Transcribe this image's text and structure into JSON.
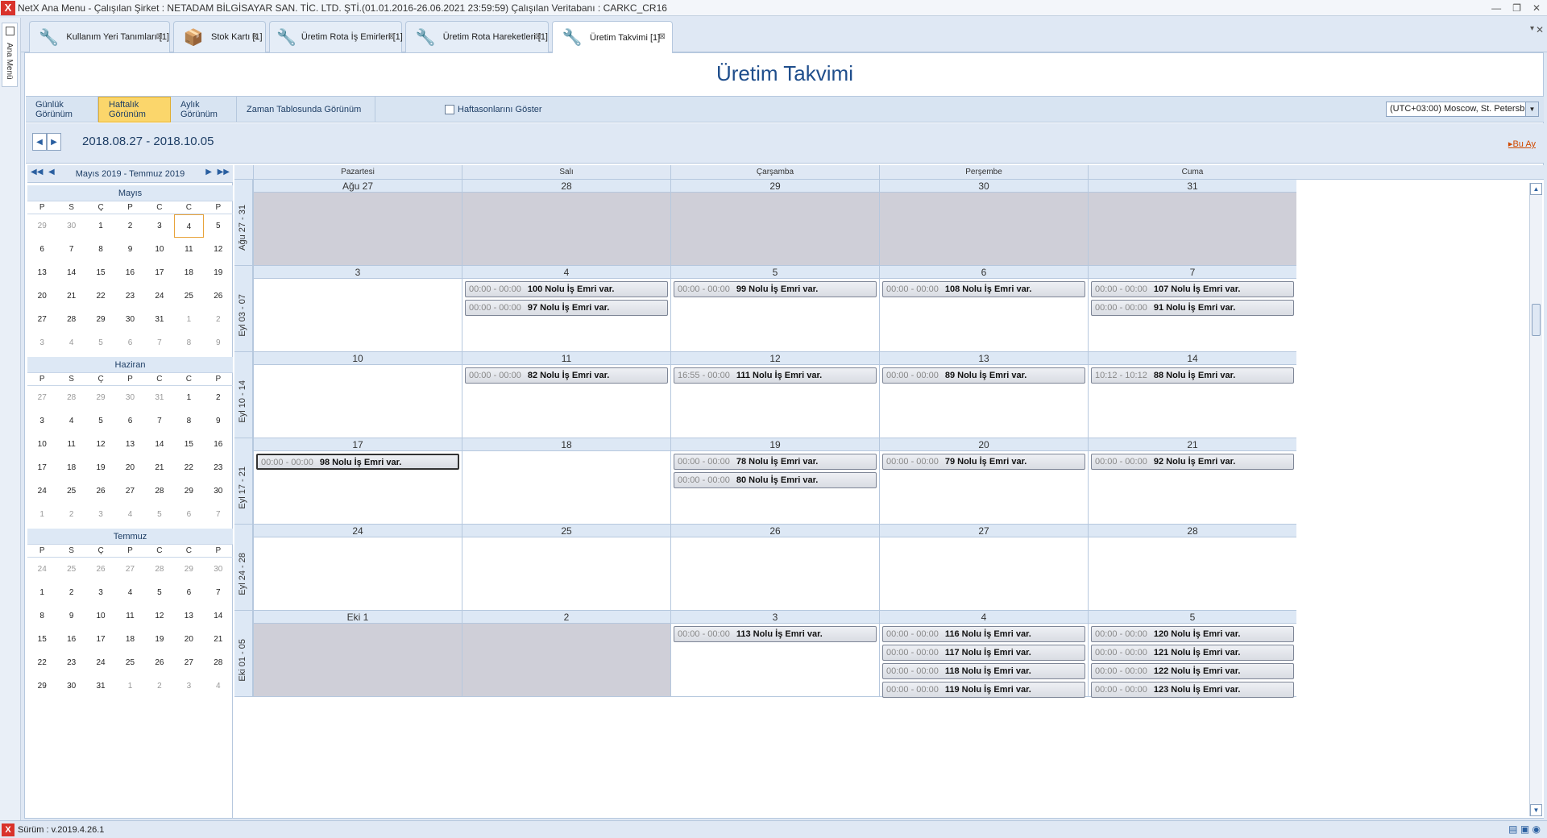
{
  "window": {
    "title": "NetX Ana Menu - Çalışılan Şirket : NETADAM BİLGİSAYAR SAN. TİC. LTD. ŞTİ.(01.01.2016-26.06.2021 23:59:59) Çalışılan Veritabanı : CARKC_CR16",
    "app_icon": "X",
    "min": "—",
    "restore": "❐",
    "close": "✕"
  },
  "left_strip": {
    "label": "Ana Menü"
  },
  "tabs": [
    {
      "label": "Kullanım Yeri Tanımları [1]",
      "icon": "tools-icon",
      "glyph": "🔧",
      "active": false
    },
    {
      "label": "Stok Kartı [1]",
      "icon": "boxes-icon",
      "glyph": "📦",
      "active": false
    },
    {
      "label": "Üretim Rota İş Emirleri [1]",
      "icon": "tools-icon",
      "glyph": "🔧",
      "active": false
    },
    {
      "label": "Üretim Rota Hareketleri [1]",
      "icon": "tools-icon",
      "glyph": "🔧",
      "active": false
    },
    {
      "label": "Üretim Takvimi [1]",
      "icon": "tools-icon",
      "glyph": "🔧",
      "active": true
    }
  ],
  "tab_close": "⊠",
  "page_title": "Üretim Takvimi",
  "toolbar": {
    "views": [
      "Günlük Görünüm",
      "Haftalık Görünüm",
      "Aylık Görünüm",
      "Zaman Tablosunda Görünüm"
    ],
    "active_view": "Haftalık Görünüm",
    "weekend_checkbox": "Haftasonlarını Göster",
    "timezone": "(UTC+03:00) Moscow, St. Petersbu"
  },
  "nav": {
    "date_range": "2018.08.27 - 2018.10.05",
    "bu_ay": "Bu Ay"
  },
  "minical": {
    "header": "Mayıs 2019 - Temmuz 2019",
    "weekdays": [
      "P",
      "S",
      "Ç",
      "P",
      "C",
      "C",
      "P"
    ],
    "months": [
      {
        "name": "Mayıs",
        "days": [
          "29",
          "30",
          "1",
          "2",
          "3",
          "4",
          "5",
          "6",
          "7",
          "8",
          "9",
          "10",
          "11",
          "12",
          "13",
          "14",
          "15",
          "16",
          "17",
          "18",
          "19",
          "20",
          "21",
          "22",
          "23",
          "24",
          "25",
          "26",
          "27",
          "28",
          "29",
          "30",
          "31",
          "1",
          "2",
          "3",
          "4",
          "5",
          "6",
          "7",
          "8",
          "9"
        ],
        "first_in": 2,
        "last_in": 32,
        "today": 5
      },
      {
        "name": "Haziran",
        "days": [
          "27",
          "28",
          "29",
          "30",
          "31",
          "1",
          "2",
          "3",
          "4",
          "5",
          "6",
          "7",
          "8",
          "9",
          "10",
          "11",
          "12",
          "13",
          "14",
          "15",
          "16",
          "17",
          "18",
          "19",
          "20",
          "21",
          "22",
          "23",
          "24",
          "25",
          "26",
          "27",
          "28",
          "29",
          "30",
          "1",
          "2",
          "3",
          "4",
          "5",
          "6",
          "7"
        ],
        "first_in": 5,
        "last_in": 34,
        "today": -1
      },
      {
        "name": "Temmuz",
        "days": [
          "24",
          "25",
          "26",
          "27",
          "28",
          "29",
          "30",
          "1",
          "2",
          "3",
          "4",
          "5",
          "6",
          "7",
          "8",
          "9",
          "10",
          "11",
          "12",
          "13",
          "14",
          "15",
          "16",
          "17",
          "18",
          "19",
          "20",
          "21",
          "22",
          "23",
          "24",
          "25",
          "26",
          "27",
          "28",
          "29",
          "30",
          "31",
          "1",
          "2",
          "3",
          "4"
        ],
        "first_in": 7,
        "last_in": 37,
        "today": -1
      }
    ]
  },
  "calendar": {
    "day_headers": [
      "Pazartesi",
      "Salı",
      "Çarşamba",
      "Perşembe",
      "Cuma"
    ],
    "weeks": [
      {
        "label": "Ağu 27 - 31",
        "grey": true,
        "days": [
          {
            "d": "Ağu 27",
            "e": []
          },
          {
            "d": "28",
            "e": []
          },
          {
            "d": "29",
            "e": []
          },
          {
            "d": "30",
            "e": []
          },
          {
            "d": "31",
            "e": []
          }
        ]
      },
      {
        "label": "Eyl 03 - 07",
        "grey": false,
        "days": [
          {
            "d": "3",
            "e": []
          },
          {
            "d": "4",
            "e": [
              {
                "t": "00:00 - 00:00",
                "x": "100 Nolu İş Emri var."
              },
              {
                "t": "00:00 - 00:00",
                "x": "97 Nolu İş Emri var."
              }
            ]
          },
          {
            "d": "5",
            "e": [
              {
                "t": "00:00 - 00:00",
                "x": "99 Nolu İş Emri var."
              }
            ]
          },
          {
            "d": "6",
            "e": [
              {
                "t": "00:00 - 00:00",
                "x": "108 Nolu İş Emri var."
              }
            ]
          },
          {
            "d": "7",
            "e": [
              {
                "t": "00:00 - 00:00",
                "x": "107 Nolu İş Emri var."
              },
              {
                "t": "00:00 - 00:00",
                "x": "91 Nolu İş Emri var."
              }
            ]
          }
        ]
      },
      {
        "label": "Eyl 10 - 14",
        "grey": false,
        "days": [
          {
            "d": "10",
            "e": []
          },
          {
            "d": "11",
            "e": [
              {
                "t": "00:00 - 00:00",
                "x": "82 Nolu İş Emri var."
              }
            ]
          },
          {
            "d": "12",
            "e": [
              {
                "t": "16:55 - 00:00",
                "x": "111 Nolu İş Emri var."
              }
            ]
          },
          {
            "d": "13",
            "e": [
              {
                "t": "00:00 - 00:00",
                "x": "89 Nolu İş Emri var."
              }
            ]
          },
          {
            "d": "14",
            "e": [
              {
                "t": "10:12 - 10:12",
                "x": "88 Nolu İş Emri var."
              }
            ]
          }
        ]
      },
      {
        "label": "Eyl 17 - 21",
        "grey": false,
        "days": [
          {
            "d": "17",
            "e": [
              {
                "t": "00:00 - 00:00",
                "x": "98 Nolu İş Emri var.",
                "sel": true
              }
            ]
          },
          {
            "d": "18",
            "e": []
          },
          {
            "d": "19",
            "e": [
              {
                "t": "00:00 - 00:00",
                "x": "78 Nolu İş Emri var."
              },
              {
                "t": "00:00 - 00:00",
                "x": "80 Nolu İş Emri var."
              }
            ]
          },
          {
            "d": "20",
            "e": [
              {
                "t": "00:00 - 00:00",
                "x": "79 Nolu İş Emri var."
              }
            ]
          },
          {
            "d": "21",
            "e": [
              {
                "t": "00:00 - 00:00",
                "x": "92 Nolu İş Emri var."
              }
            ]
          }
        ]
      },
      {
        "label": "Eyl 24 - 28",
        "grey": false,
        "days": [
          {
            "d": "24",
            "e": []
          },
          {
            "d": "25",
            "e": []
          },
          {
            "d": "26",
            "e": []
          },
          {
            "d": "27",
            "e": []
          },
          {
            "d": "28",
            "e": []
          }
        ]
      },
      {
        "label": "Eki 01 - 05",
        "grey": false,
        "greyFirst2": true,
        "days": [
          {
            "d": "Eki 1",
            "e": []
          },
          {
            "d": "2",
            "e": []
          },
          {
            "d": "3",
            "e": [
              {
                "t": "00:00 - 00:00",
                "x": "113 Nolu İş Emri var."
              }
            ]
          },
          {
            "d": "4",
            "e": [
              {
                "t": "00:00 - 00:00",
                "x": "116 Nolu İş Emri var."
              },
              {
                "t": "00:00 - 00:00",
                "x": "117 Nolu İş Emri var."
              },
              {
                "t": "00:00 - 00:00",
                "x": "118 Nolu İş Emri var."
              },
              {
                "t": "00:00 - 00:00",
                "x": "119 Nolu İş Emri var."
              }
            ]
          },
          {
            "d": "5",
            "e": [
              {
                "t": "00:00 - 00:00",
                "x": "120 Nolu İş Emri var."
              },
              {
                "t": "00:00 - 00:00",
                "x": "121 Nolu İş Emri var."
              },
              {
                "t": "00:00 - 00:00",
                "x": "122 Nolu İş Emri var."
              },
              {
                "t": "00:00 - 00:00",
                "x": "123 Nolu İş Emri var."
              }
            ]
          }
        ]
      }
    ]
  },
  "status": {
    "icon": "X",
    "version": "Sürüm : v.2019.4.26.1",
    "tray": "▤ ▣ ◉"
  }
}
